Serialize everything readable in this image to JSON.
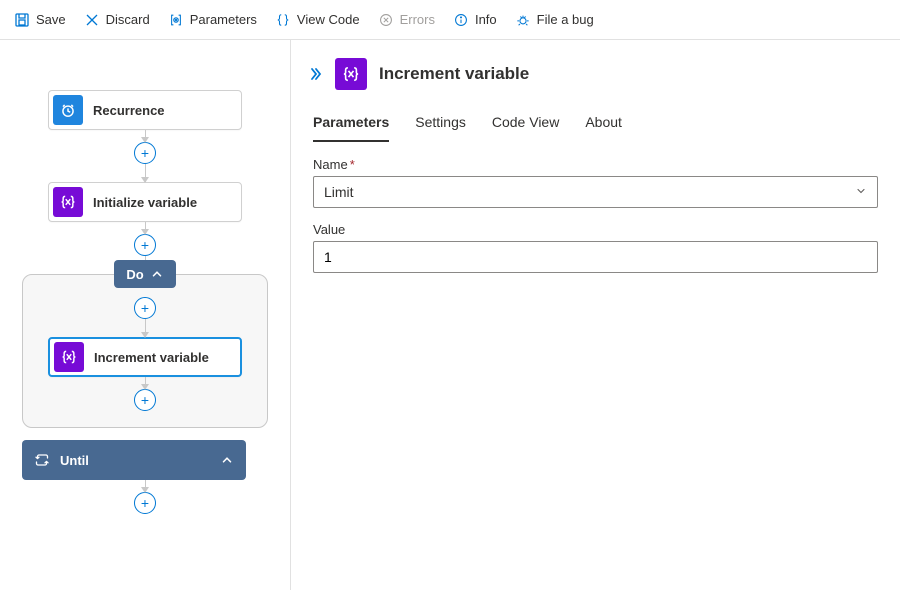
{
  "toolbar": {
    "save": "Save",
    "discard": "Discard",
    "parameters": "Parameters",
    "viewCode": "View Code",
    "errors": "Errors",
    "info": "Info",
    "fileBug": "File a bug"
  },
  "designer": {
    "recurrence": "Recurrence",
    "initVar": "Initialize variable",
    "doLabel": "Do",
    "incrementVar": "Increment variable",
    "until": "Until"
  },
  "panel": {
    "title": "Increment variable",
    "tabs": {
      "parameters": "Parameters",
      "settings": "Settings",
      "codeView": "Code View",
      "about": "About"
    },
    "nameLabel": "Name",
    "nameValue": "Limit",
    "valueLabel": "Value",
    "valueValue": "1"
  }
}
